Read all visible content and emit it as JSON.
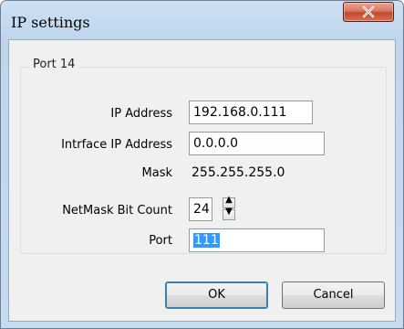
{
  "window": {
    "title": "IP settings"
  },
  "group": {
    "title": "Port 14"
  },
  "fields": {
    "ip_address": {
      "label": "IP Address",
      "value": "192.168.0.111"
    },
    "interface_ip": {
      "label": "Intrface IP Address",
      "value": "0.0.0.0"
    },
    "mask": {
      "label": "Mask",
      "value": "255.255.255.0"
    },
    "netmask_bits": {
      "label": "NetMask Bit Count",
      "value": "24",
      "up": "▲",
      "down": "▼"
    },
    "port": {
      "label": "Port",
      "value": "111"
    }
  },
  "buttons": {
    "ok": "OK",
    "cancel": "Cancel"
  },
  "icons": {
    "close": "close-icon"
  },
  "colors": {
    "selection": "#3399ff",
    "close_button": "#c3462a"
  }
}
